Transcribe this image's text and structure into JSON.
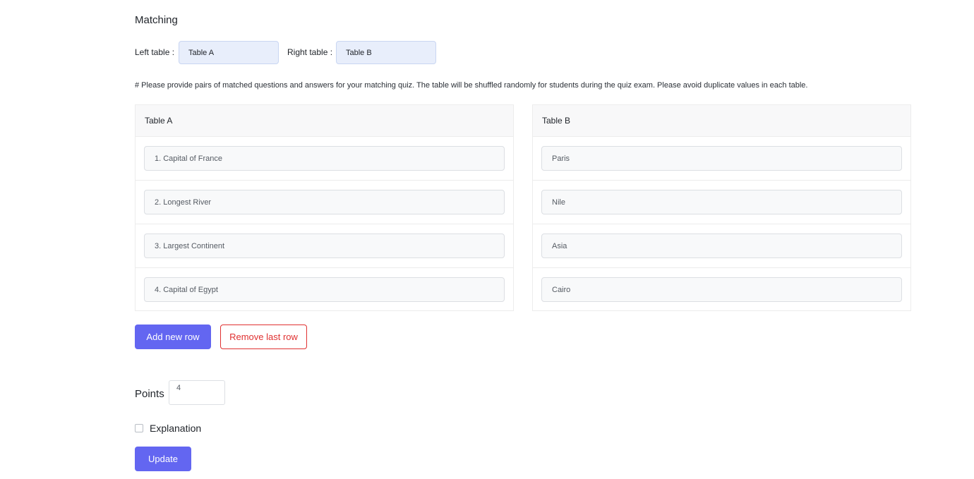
{
  "section_title": "Matching",
  "left_table": {
    "label": "Left table :",
    "value": "Table A"
  },
  "right_table": {
    "label": "Right table :",
    "value": "Table B"
  },
  "help_text": "# Please provide pairs of matched questions and answers for your matching quiz. The table will be shuffled randomly for students during the quiz exam. Please avoid duplicate values in each table.",
  "table_a": {
    "header": "Table A",
    "rows": [
      "1. Capital of France",
      "2. Longest River",
      "3. Largest Continent",
      "4. Capital of Egypt"
    ]
  },
  "table_b": {
    "header": "Table B",
    "rows": [
      "Paris",
      "Nile",
      "Asia",
      "Cairo"
    ]
  },
  "buttons": {
    "add_row": "Add new row",
    "remove_row": "Remove last row",
    "update": "Update"
  },
  "points": {
    "label": "Points",
    "value": "4"
  },
  "explanation": {
    "label": "Explanation",
    "checked": false
  },
  "colors": {
    "primary": "#6366f1",
    "danger": "#e03131",
    "table_input_bg": "#e8eefb"
  }
}
